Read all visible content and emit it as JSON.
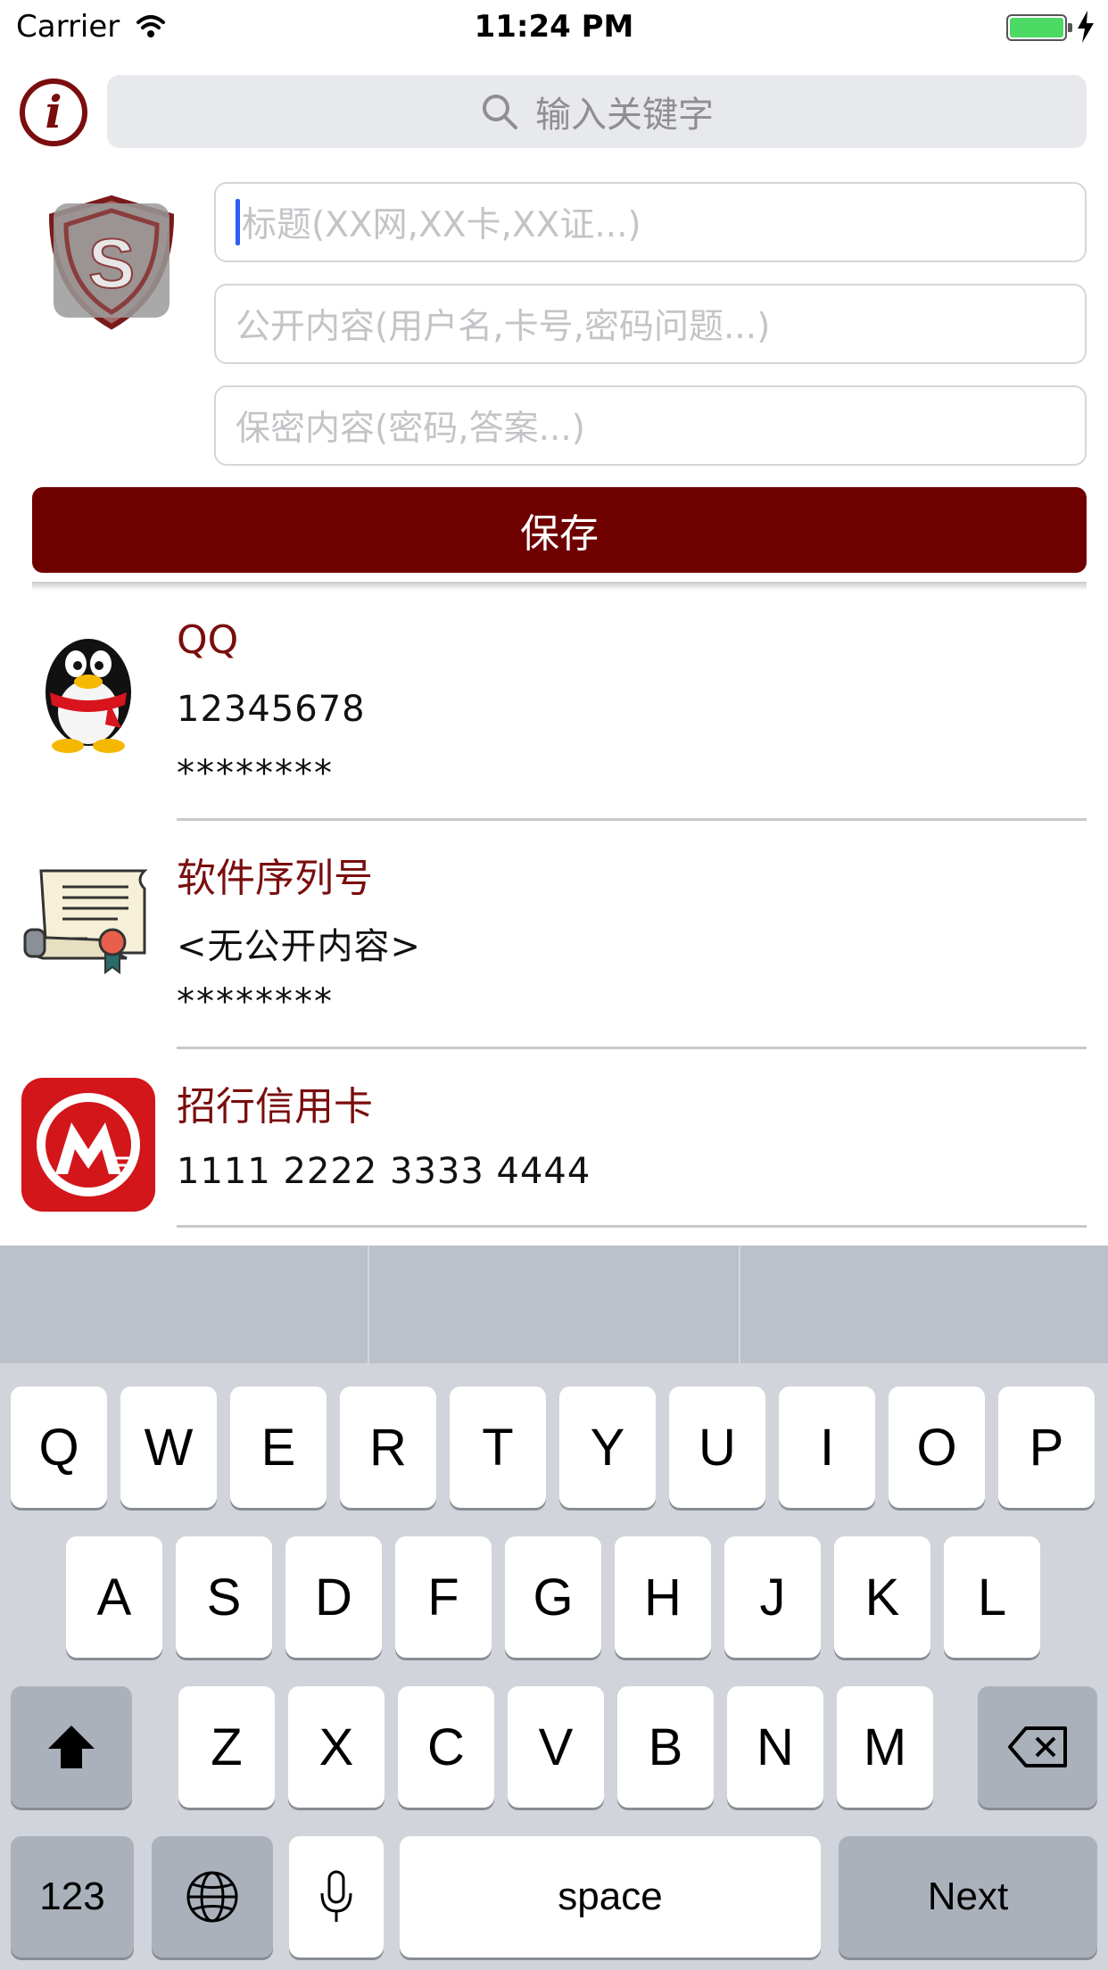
{
  "status_bar": {
    "carrier": "Carrier",
    "time": "11:24 PM"
  },
  "header": {
    "info_label": "i",
    "search_placeholder": "输入关键字"
  },
  "form": {
    "title_placeholder": "标题(XX网,XX卡,XX证...)",
    "public_placeholder": "公开内容(用户名,卡号,密码问题...)",
    "secret_placeholder": "保密内容(密码,答案...)",
    "save_label": "保存"
  },
  "items": [
    {
      "title": "QQ",
      "public": "12345678",
      "secret": "********",
      "icon": "penguin-icon"
    },
    {
      "title": "软件序列号",
      "public": "<无公开内容>",
      "secret": "********",
      "icon": "certificate-scroll-icon"
    },
    {
      "title": "招行信用卡",
      "public": "1111 2222 3333 4444",
      "icon": "bank-logo-icon"
    }
  ],
  "keyboard": {
    "row1": [
      "Q",
      "W",
      "E",
      "R",
      "T",
      "Y",
      "U",
      "I",
      "O",
      "P"
    ],
    "row2": [
      "A",
      "S",
      "D",
      "F",
      "G",
      "H",
      "J",
      "K",
      "L"
    ],
    "row3": [
      "Z",
      "X",
      "C",
      "V",
      "B",
      "N",
      "M"
    ],
    "numbers_label": "123",
    "space_label": "space",
    "next_label": "Next"
  },
  "colors": {
    "accent": "#6e0000",
    "title_text": "#7a0d0d",
    "battery": "#4cd964",
    "cursor": "#2f5cf5"
  }
}
